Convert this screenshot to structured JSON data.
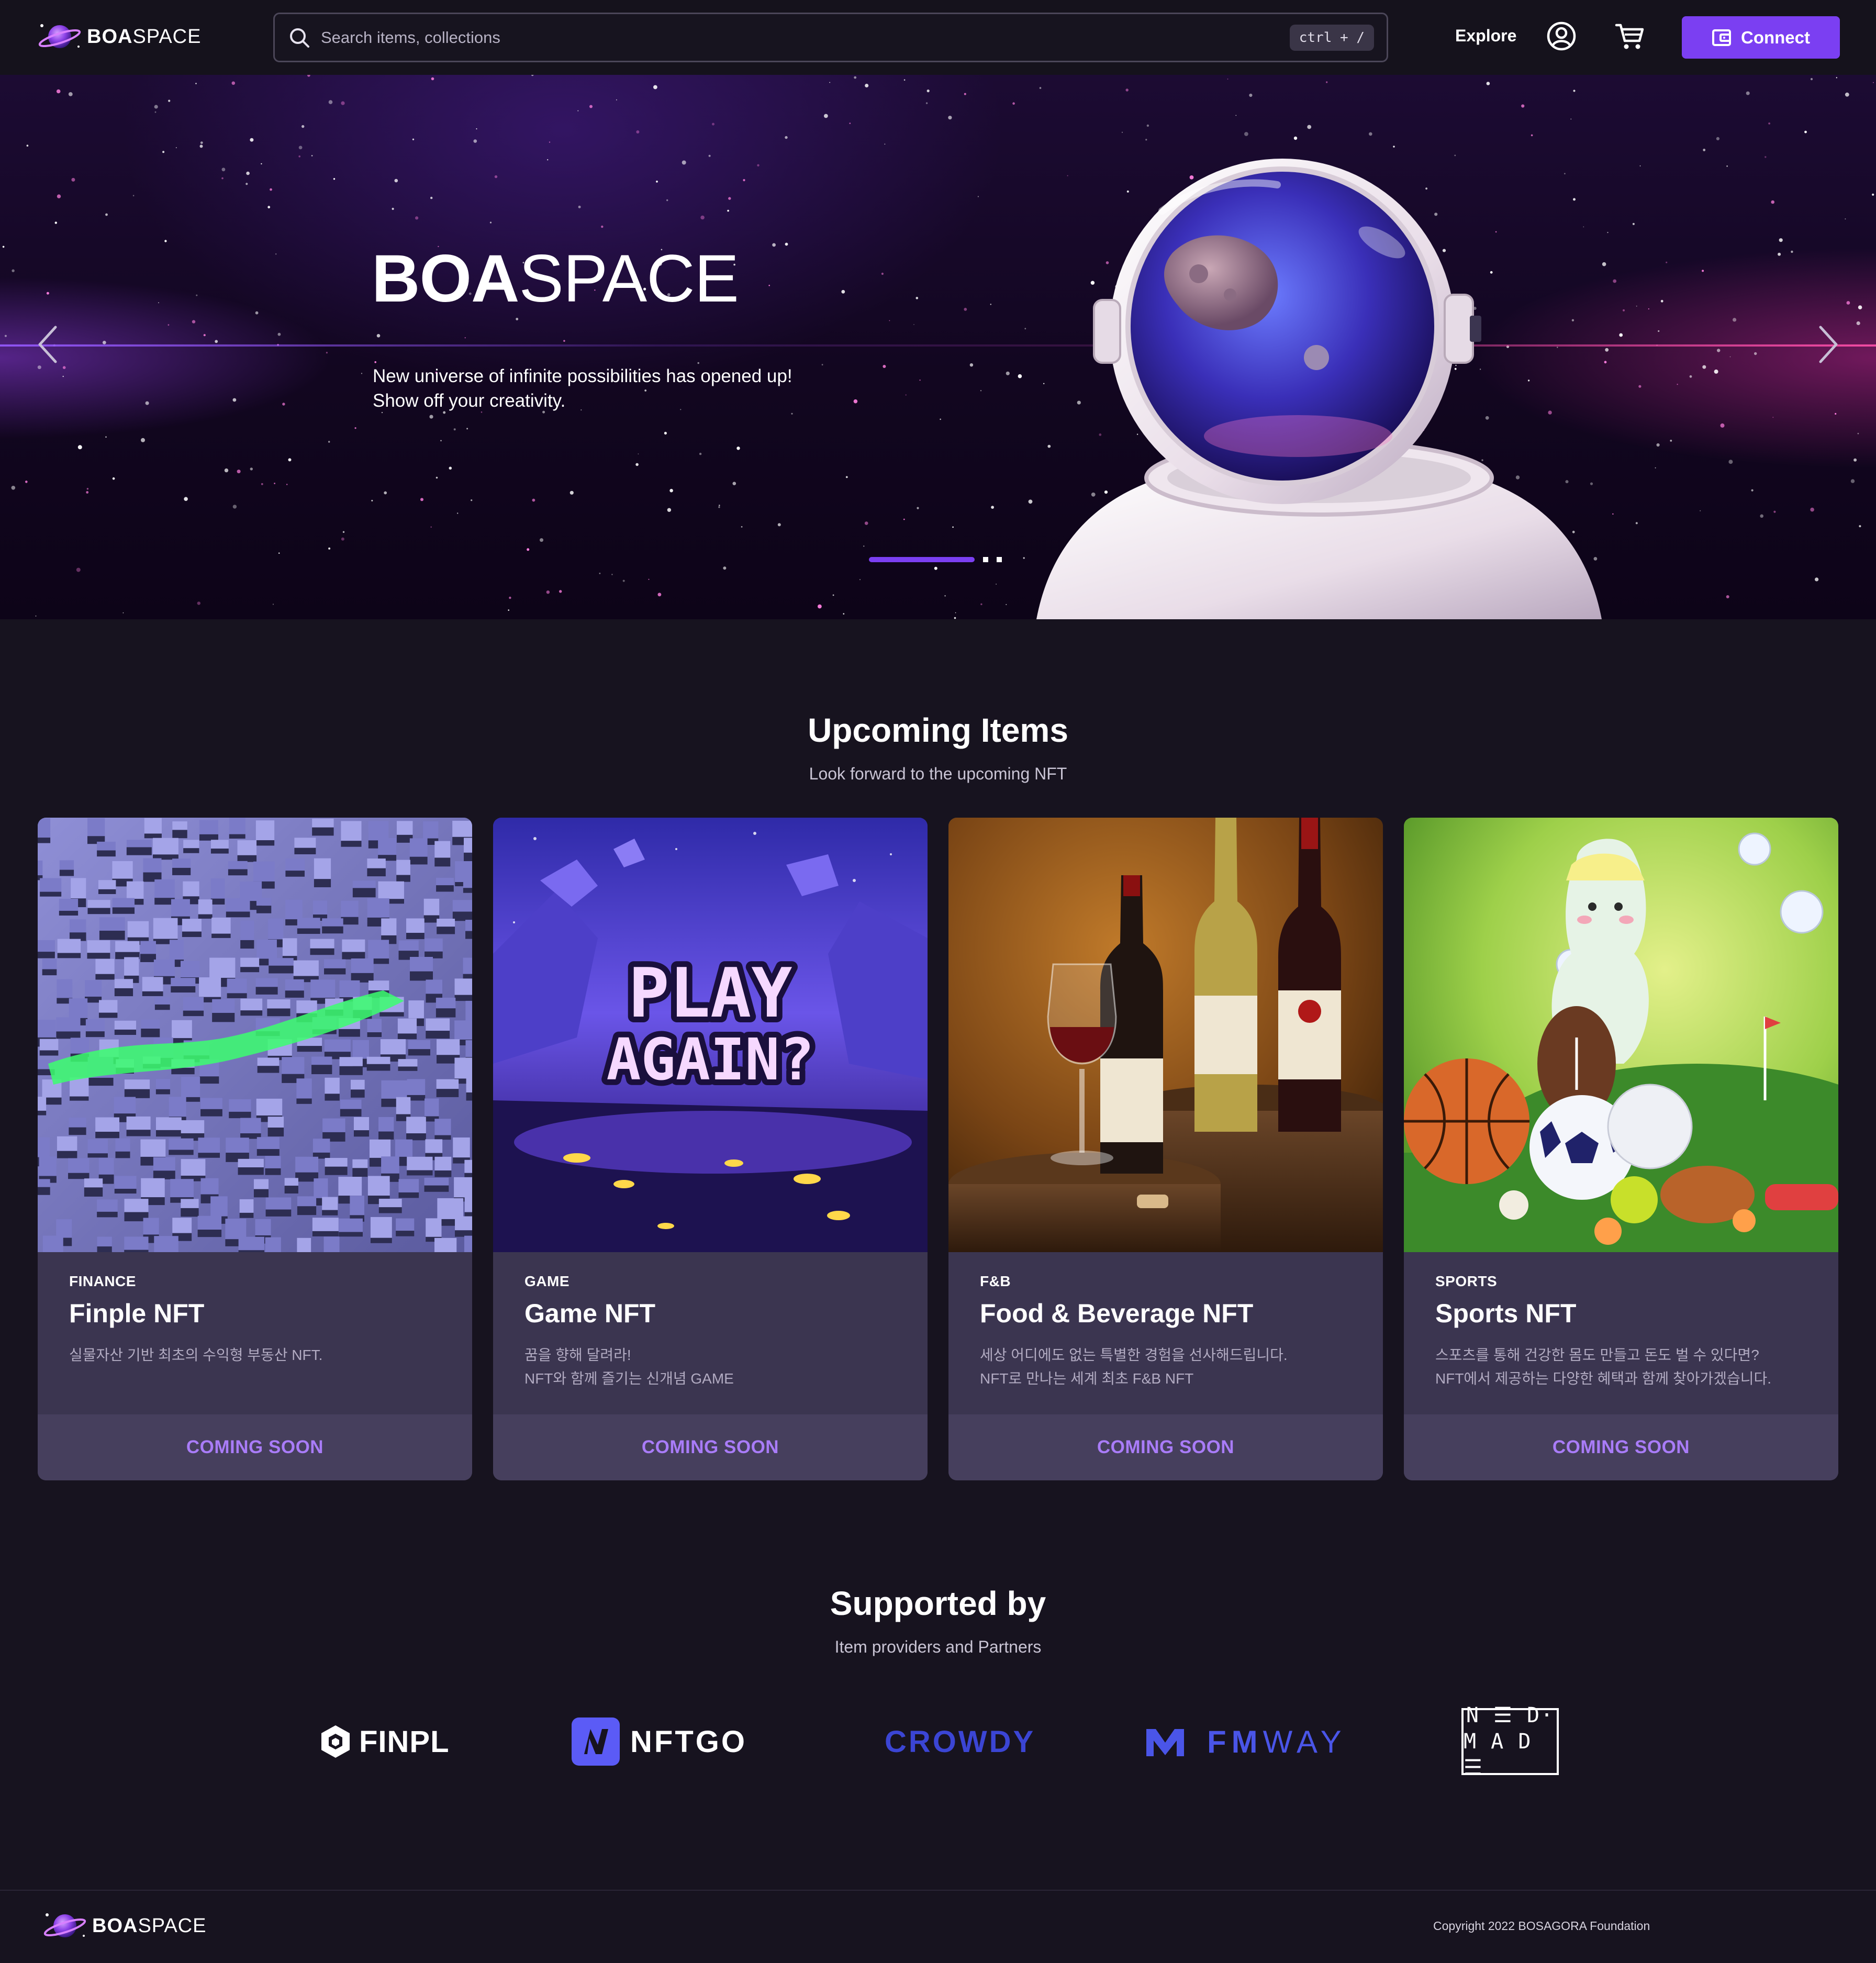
{
  "header": {
    "logo_bold": "BOA",
    "logo_light": "SPACE",
    "search_placeholder": "Search items, collections",
    "search_shortcut": "ctrl + /",
    "nav_explore": "Explore",
    "connect_label": "Connect",
    "icons": [
      "search-icon",
      "user-icon",
      "cart-icon",
      "wallet-icon"
    ]
  },
  "hero": {
    "title_bold": "BOA",
    "title_light": "SPACE",
    "subtitle_line1": "New universe of infinite possibilities has opened up!",
    "subtitle_line2": "Show off your creativity.",
    "slide_count": 3,
    "active_slide": 1
  },
  "upcoming": {
    "title": "Upcoming Items",
    "subtitle": "Look forward to the upcoming NFT",
    "cards": [
      {
        "category": "FINANCE",
        "title": "Finple NFT",
        "description": "실물자산 기반 최초의 수익형 부동산 NFT.",
        "button": "COMING SOON",
        "image_text": ""
      },
      {
        "category": "GAME",
        "title": "Game NFT",
        "description": "꿈을 향해 달려라!\nNFT와 함께 즐기는 신개념 GAME",
        "button": "COMING SOON",
        "image_text": "PLAY AGAIN?"
      },
      {
        "category": "F&B",
        "title": "Food & Beverage NFT",
        "description": "세상 어디에도 없는 특별한 경험을 선사해드립니다.\nNFT로 만나는 세계 최초 F&B NFT",
        "button": "COMING SOON",
        "image_text": ""
      },
      {
        "category": "SPORTS",
        "title": "Sports NFT",
        "description": "스포츠를 통해 건강한 몸도 만들고 돈도 벌 수 있다면?\nNFT에서 제공하는 다양한 혜택과 함께 찾아가겠습니다.",
        "button": "COMING SOON",
        "image_text": ""
      }
    ]
  },
  "supported": {
    "title": "Supported by",
    "subtitle": "Item providers and Partners",
    "partners": [
      {
        "name": "FINPL"
      },
      {
        "name": "NFTGO"
      },
      {
        "name": "CROWDY"
      },
      {
        "name": "FMWAY",
        "bold": "FM",
        "light": "WAY"
      },
      {
        "name": "NEEDMADE",
        "line1": "N ☰ D·",
        "line2": "M A D ☰"
      }
    ]
  },
  "footer": {
    "logo_bold": "BOA",
    "logo_light": "SPACE",
    "copyright": "Copyright 2022 BOSAGORA Foundation"
  },
  "colors": {
    "background": "#17131f",
    "accent": "#7b3ff2",
    "card": "#3b3550",
    "button_text": "#a97cf8"
  }
}
